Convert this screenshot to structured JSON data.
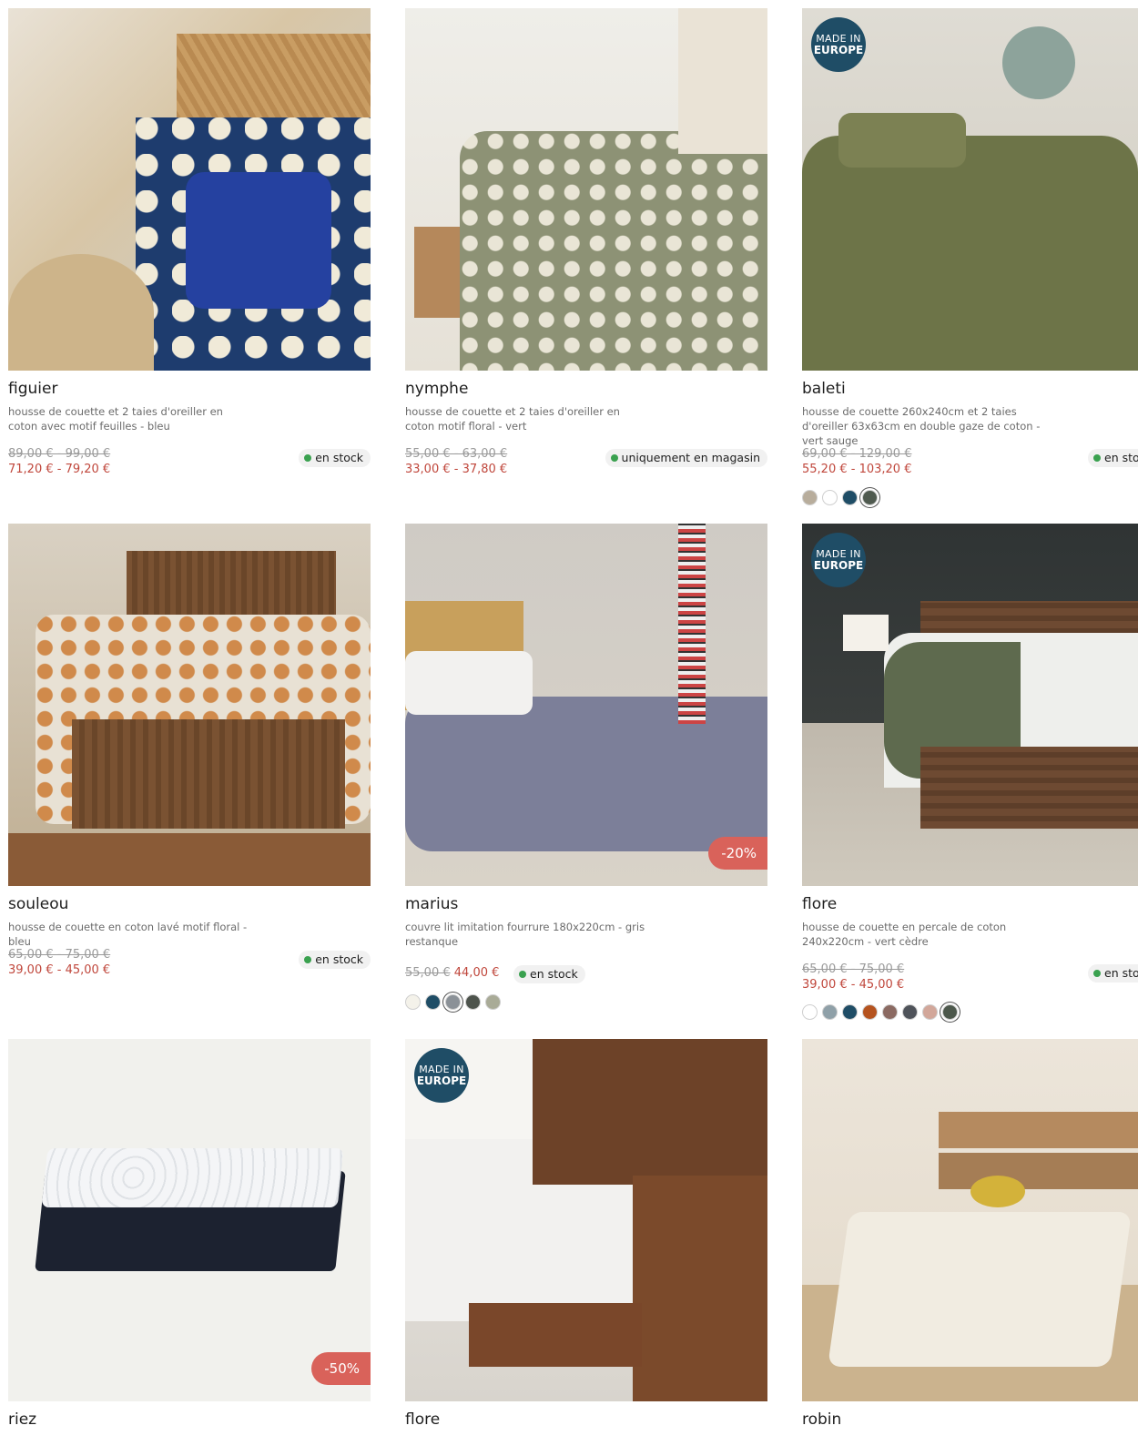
{
  "badges": {
    "made_in_l1": "MADE IN",
    "made_in_l2": "EUROPE"
  },
  "products": [
    {
      "name": "figuier",
      "desc": "housse de couette et 2 taies d'oreiller en coton avec motif feuilles - bleu",
      "old": "89,00 € - 99,00 €",
      "new": "71,20 € - 79,20 €",
      "stock": "en stock"
    },
    {
      "name": "nymphe",
      "desc": "housse de couette et 2 taies d'oreiller en coton motif floral - vert",
      "old": "55,00 € - 63,00 €",
      "new": "33,00 € - 37,80 €",
      "stock": "uniquement en magasin"
    },
    {
      "name": "baleti",
      "desc": "housse de couette 260x240cm et 2 taies d'oreiller 63x63cm en double gaze de coton - vert sauge",
      "old": "69,00 € - 129,00 €",
      "new": "55,20 € - 103,20 €",
      "stock": "en stock",
      "swatches": [
        "#b8ad9c",
        "#ffffff",
        "#1f4d66",
        "#4f5a4f"
      ]
    },
    {
      "name": "souleou",
      "desc": "housse de couette en coton lavé motif floral - bleu",
      "old": "65,00 € - 75,00 €",
      "new": "39,00 € - 45,00 €",
      "stock": "en stock"
    },
    {
      "name": "marius",
      "desc": "couvre lit imitation fourrure 180x220cm - gris restanque",
      "old": "55,00 €",
      "new": "44,00 €",
      "stock": "en stock",
      "promo": "-20%",
      "swatches": [
        "#f4f2ea",
        "#1f4d66",
        "#8b9197",
        "#4d534c",
        "#a9ab97"
      ]
    },
    {
      "name": "flore",
      "desc": "housse de couette en percale de coton 240x220cm - vert cèdre",
      "old": "65,00 € - 75,00 €",
      "new": "39,00 € - 45,00 €",
      "stock": "en stock",
      "swatches": [
        "#ffffff",
        "#8fa0a8",
        "#1f4d66",
        "#b5531f",
        "#8b6a62",
        "#4f535a",
        "#d2a79a",
        "#4d584c"
      ]
    },
    {
      "name": "riez",
      "promo": "-50%"
    },
    {
      "name": "flore"
    },
    {
      "name": "robin"
    }
  ]
}
